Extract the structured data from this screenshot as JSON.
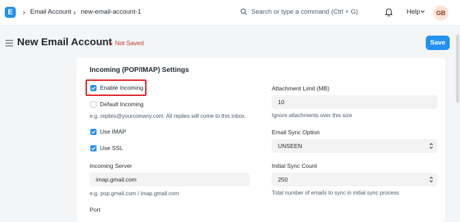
{
  "nav": {
    "logo_letter": "E",
    "breadcrumb": [
      "Email Account",
      "new-email-account-1"
    ],
    "search_placeholder": "Search or type a command (Ctrl + G)",
    "help_label": "Help",
    "avatar_initials": "GB"
  },
  "page": {
    "title": "New Email Account",
    "status": "Not Saved",
    "save_label": "Save"
  },
  "form": {
    "section_title": "Incoming (POP/IMAP) Settings",
    "enable_incoming": {
      "label": "Enable Incoming",
      "checked": true
    },
    "default_incoming": {
      "label": "Default Incoming",
      "checked": false
    },
    "default_incoming_desc": "e.g. replies@yourcomany.com. All replies will come to this inbox.",
    "use_imap": {
      "label": "Use IMAP",
      "checked": true
    },
    "use_ssl": {
      "label": "Use SSL",
      "checked": true
    },
    "incoming_server": {
      "label": "Incoming Server",
      "value": "imap.gmail.com",
      "desc": "e.g. pop.gmail.com / imap.gmail.com"
    },
    "port_label": "Port",
    "attachment_limit": {
      "label": "Attachment Limit (MB)",
      "value": "10",
      "desc": "Ignore attachments over this size"
    },
    "email_sync_option": {
      "label": "Email Sync Option",
      "value": "UNSEEN"
    },
    "initial_sync_count": {
      "label": "Initial Sync Count",
      "value": "250",
      "desc": "Total number of emails to sync in initial sync process"
    }
  },
  "colors": {
    "accent": "#2490ef",
    "highlight": "#e01b24"
  }
}
